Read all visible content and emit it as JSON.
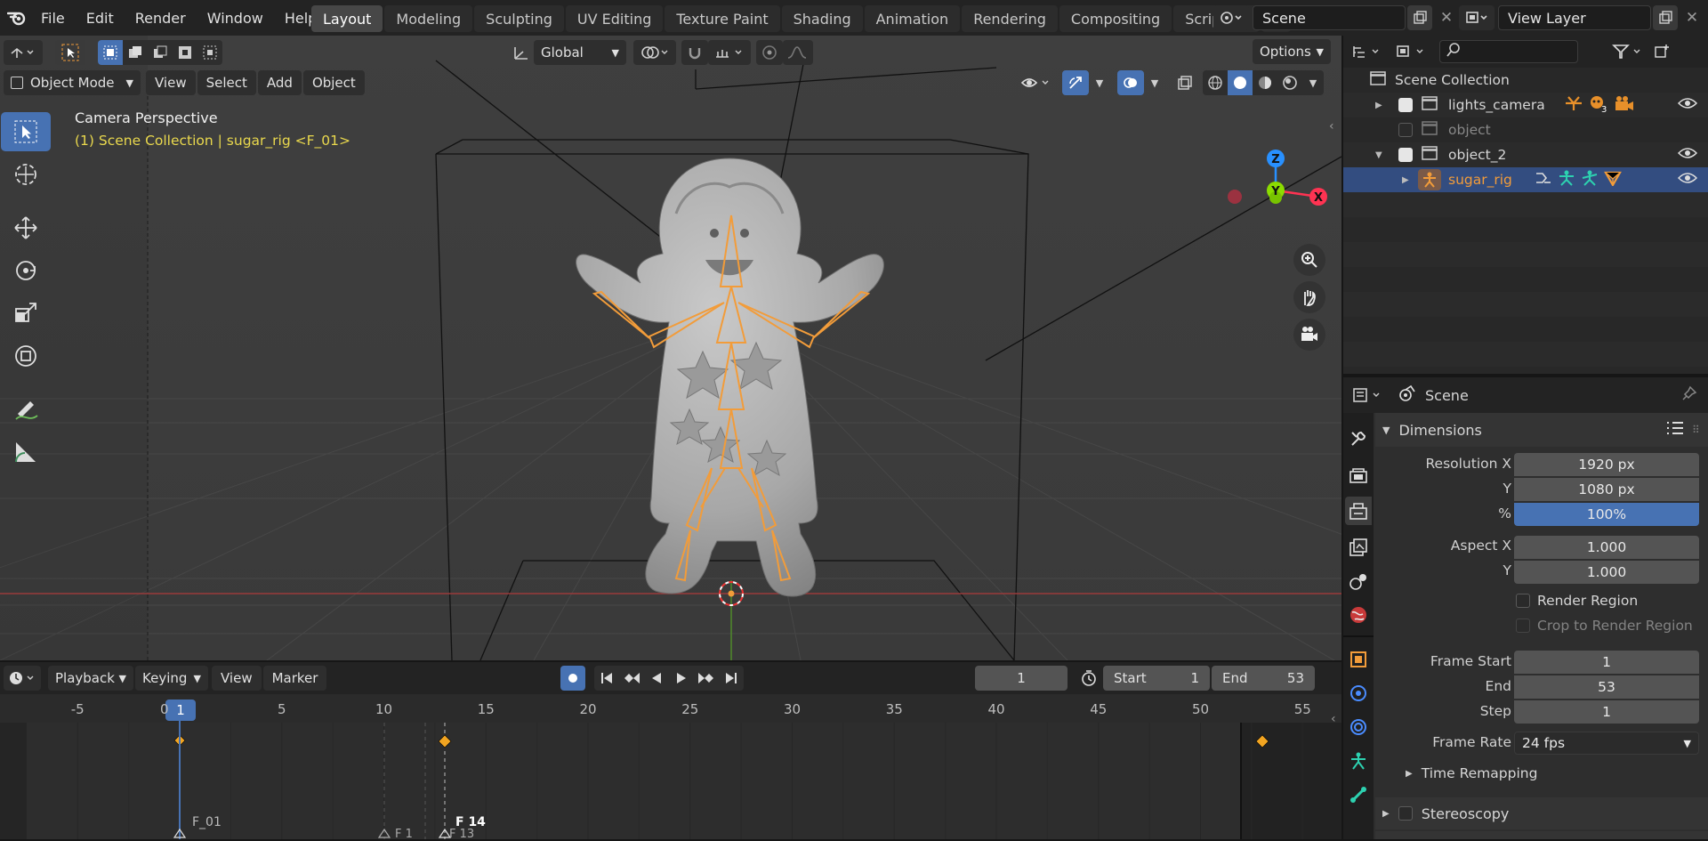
{
  "menus": [
    "File",
    "Edit",
    "Render",
    "Window",
    "Help"
  ],
  "workspaces": [
    "Layout",
    "Modeling",
    "Sculpting",
    "UV Editing",
    "Texture Paint",
    "Shading",
    "Animation",
    "Rendering",
    "Compositing",
    "Scripting"
  ],
  "scene_name": "Scene",
  "view_layer": "View Layer",
  "viewport": {
    "mode": "Object Mode",
    "menus": [
      "View",
      "Select",
      "Add",
      "Object"
    ],
    "transform": "Global",
    "options": "Options",
    "title": "Camera Perspective",
    "subtitle": "(1) Scene Collection | sugar_rig <F_01>",
    "gizmo": {
      "z": "Z",
      "y": "Y",
      "x": "X"
    }
  },
  "timeline": {
    "menus": [
      "Playback",
      "Keying",
      "View",
      "Marker"
    ],
    "current_frame": "1",
    "start_label": "Start",
    "start": "1",
    "end_label": "End",
    "end": "53",
    "ruler": [
      "-5",
      "0",
      "5",
      "10",
      "15",
      "20",
      "25",
      "30",
      "35",
      "40",
      "45",
      "50",
      "55"
    ],
    "current_label": "1",
    "markers": [
      "F_01",
      "F 14",
      "F 1",
      "F 13"
    ]
  },
  "outliner": {
    "root": "Scene Collection",
    "items": [
      {
        "name": "lights_camera",
        "count": "3"
      },
      {
        "name": "object"
      },
      {
        "name": "object_2"
      },
      {
        "name": "sugar_rig"
      }
    ]
  },
  "properties": {
    "context": "Scene",
    "panel": "Dimensions",
    "res_x_label": "Resolution X",
    "res_x": "1920 px",
    "res_y_label": "Y",
    "res_y": "1080 px",
    "pct_label": "%",
    "pct": "100%",
    "aspect_x_label": "Aspect X",
    "aspect_x": "1.000",
    "aspect_y_label": "Y",
    "aspect_y": "1.000",
    "render_region": "Render Region",
    "crop_region": "Crop to Render Region",
    "frame_start_label": "Frame Start",
    "frame_start": "1",
    "end_label": "End",
    "end": "53",
    "step_label": "Step",
    "step": "1",
    "frame_rate_label": "Frame Rate",
    "frame_rate": "24 fps",
    "time_remapping": "Time Remapping",
    "stereoscopy": "Stereoscopy"
  },
  "colors": {
    "accent": "#4772b3",
    "selection": "#f29c3a",
    "axis_x": "#ff3352",
    "axis_y": "#8bdc00",
    "axis_z": "#2890ff"
  }
}
